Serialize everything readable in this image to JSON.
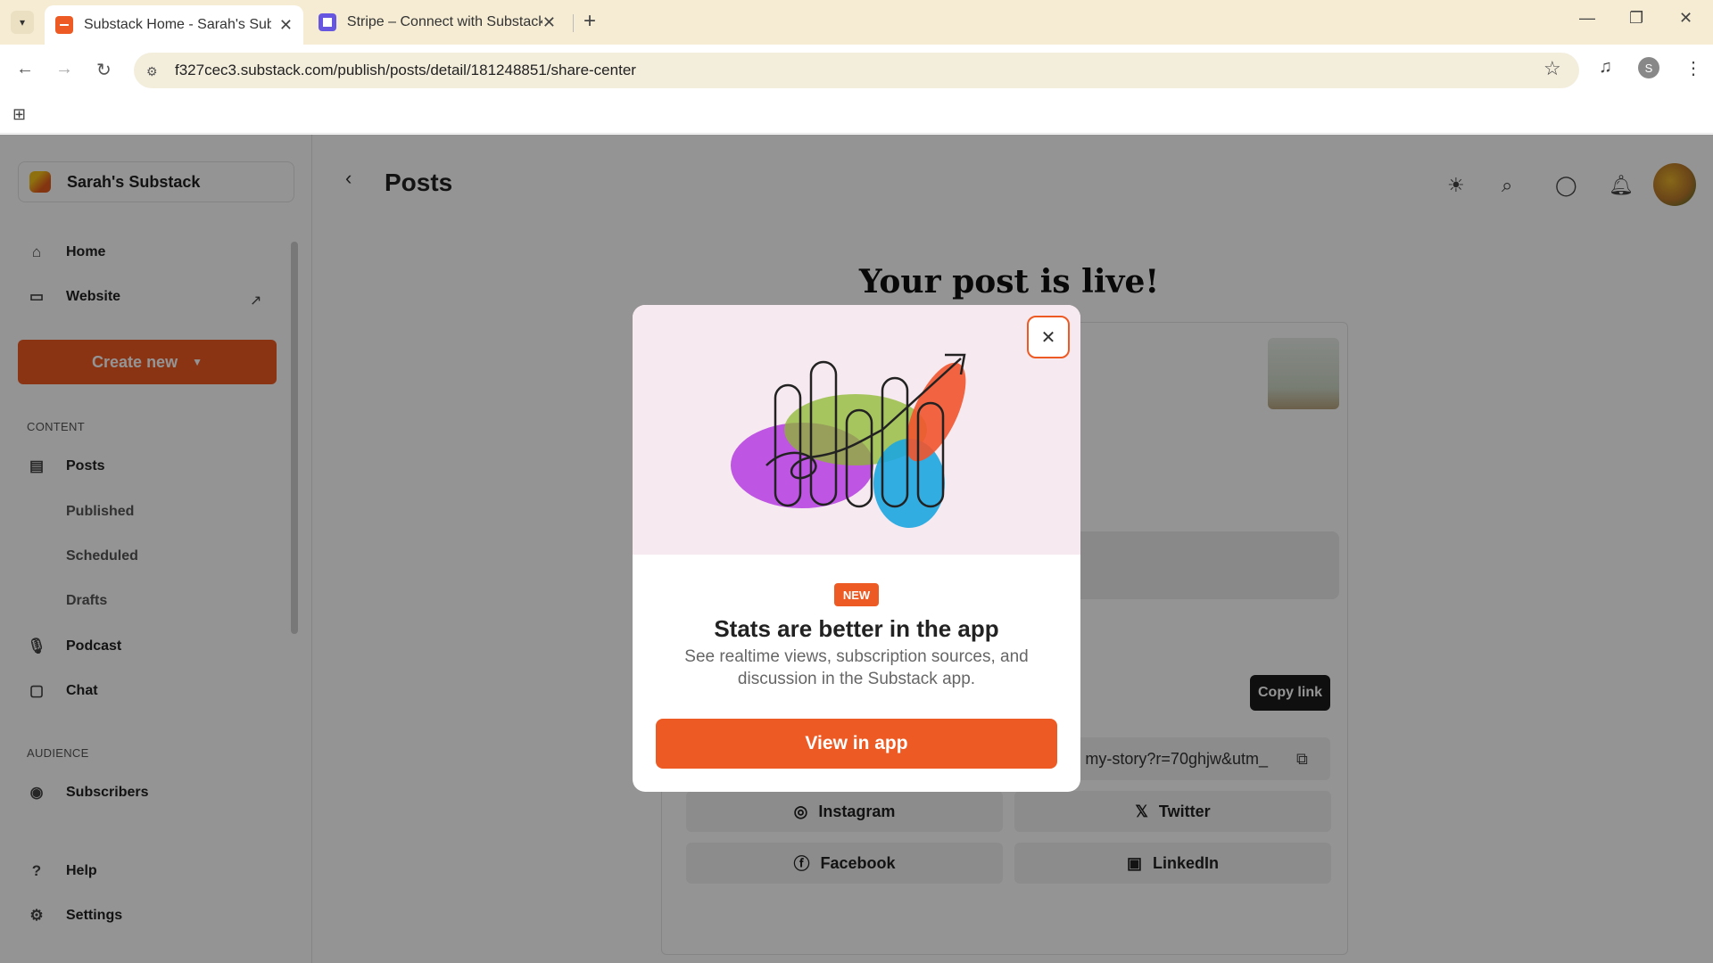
{
  "browser": {
    "tabs": [
      {
        "title": "Substack Home - Sarah's Subst",
        "active": true
      },
      {
        "title": "Stripe – Connect with Substack",
        "active": false
      }
    ],
    "url": "f327cec3.substack.com/publish/posts/detail/181248851/share-center",
    "profile_initial": "S"
  },
  "sidebar": {
    "publication": "Sarah's Substack",
    "home": "Home",
    "website": "Website",
    "create_new": "Create new",
    "content_section": "CONTENT",
    "posts": "Posts",
    "published": "Published",
    "scheduled": "Scheduled",
    "drafts": "Drafts",
    "podcast": "Podcast",
    "chat": "Chat",
    "audience_section": "AUDIENCE",
    "subscribers": "Subscribers",
    "help": "Help",
    "settings": "Settings"
  },
  "header": {
    "title": "Posts"
  },
  "main": {
    "live_title": "Your post is live!",
    "copy_link": "Copy link",
    "post_url": "my-story?r=70ghjw&utm_",
    "share": {
      "instagram": "Instagram",
      "twitter": "Twitter",
      "facebook": "Facebook",
      "linkedin": "LinkedIn"
    }
  },
  "modal": {
    "badge": "NEW",
    "title": "Stats are better in the app",
    "description": "See realtime views, subscription sources, and discussion in the Substack app.",
    "button": "View in app"
  },
  "colors": {
    "brand": "#ee5a24",
    "chrome": "#f5ecd3"
  }
}
